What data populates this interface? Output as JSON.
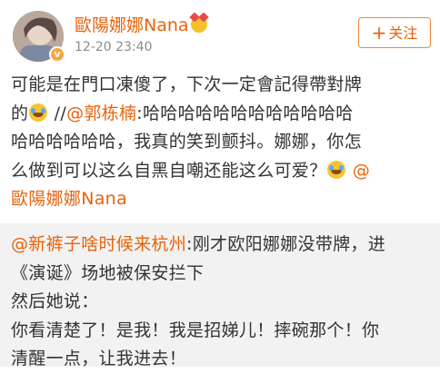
{
  "post": {
    "username": "歐陽娜娜Nana",
    "timestamp": "12-20 23:40",
    "follow_label": "关注",
    "follow_plus": "+",
    "verified_mark": "v",
    "content_lines": [
      {
        "parts": [
          {
            "t": "text",
            "v": "可能是在門口凍傻了，下次一定會記得帶對牌"
          }
        ]
      },
      {
        "parts": [
          {
            "t": "text",
            "v": "的"
          },
          {
            "t": "face"
          },
          {
            "t": "text",
            "v": " //"
          },
          {
            "t": "mention",
            "v": "@郭栋楠"
          },
          {
            "t": "text",
            "v": ":哈哈哈哈哈哈哈哈哈哈哈哈"
          }
        ]
      },
      {
        "parts": [
          {
            "t": "text",
            "v": "哈哈哈哈哈哈，我真的笑到颤抖。娜娜，你怎"
          }
        ]
      },
      {
        "parts": [
          {
            "t": "text",
            "v": "么做到可以这么自黑自嘲还能这么可爱？"
          },
          {
            "t": "face"
          },
          {
            "t": "text",
            "v": " "
          },
          {
            "t": "mention",
            "v": "@"
          }
        ]
      },
      {
        "parts": [
          {
            "t": "mention",
            "v": "歐陽娜娜Nana"
          }
        ]
      }
    ]
  },
  "repost": {
    "lines": [
      {
        "parts": [
          {
            "t": "mention",
            "v": "@新裤子啥时候来杭州"
          },
          {
            "t": "text",
            "v": ":刚才欧阳娜娜没带牌，进"
          }
        ]
      },
      {
        "parts": [
          {
            "t": "text",
            "v": "《演诞》场地被保安拦下"
          }
        ]
      },
      {
        "parts": [
          {
            "t": "text",
            "v": "然后她说："
          }
        ]
      },
      {
        "parts": [
          {
            "t": "text",
            "v": "你看清楚了！是我！我是招娣儿！摔碗那个！你"
          }
        ]
      },
      {
        "parts": [
          {
            "t": "text",
            "v": "清醒一点，让我进去！"
          }
        ]
      }
    ]
  },
  "colors": {
    "accent": "#e8630a",
    "text": "#333333",
    "meta": "#8c8c8c",
    "repost_bg": "#f2f2f2"
  },
  "icons": {
    "username_badge": "vip-emoji-icon",
    "inline_emoji": "laugh-cry-emoji-icon",
    "verified": "verified-badge-icon"
  }
}
